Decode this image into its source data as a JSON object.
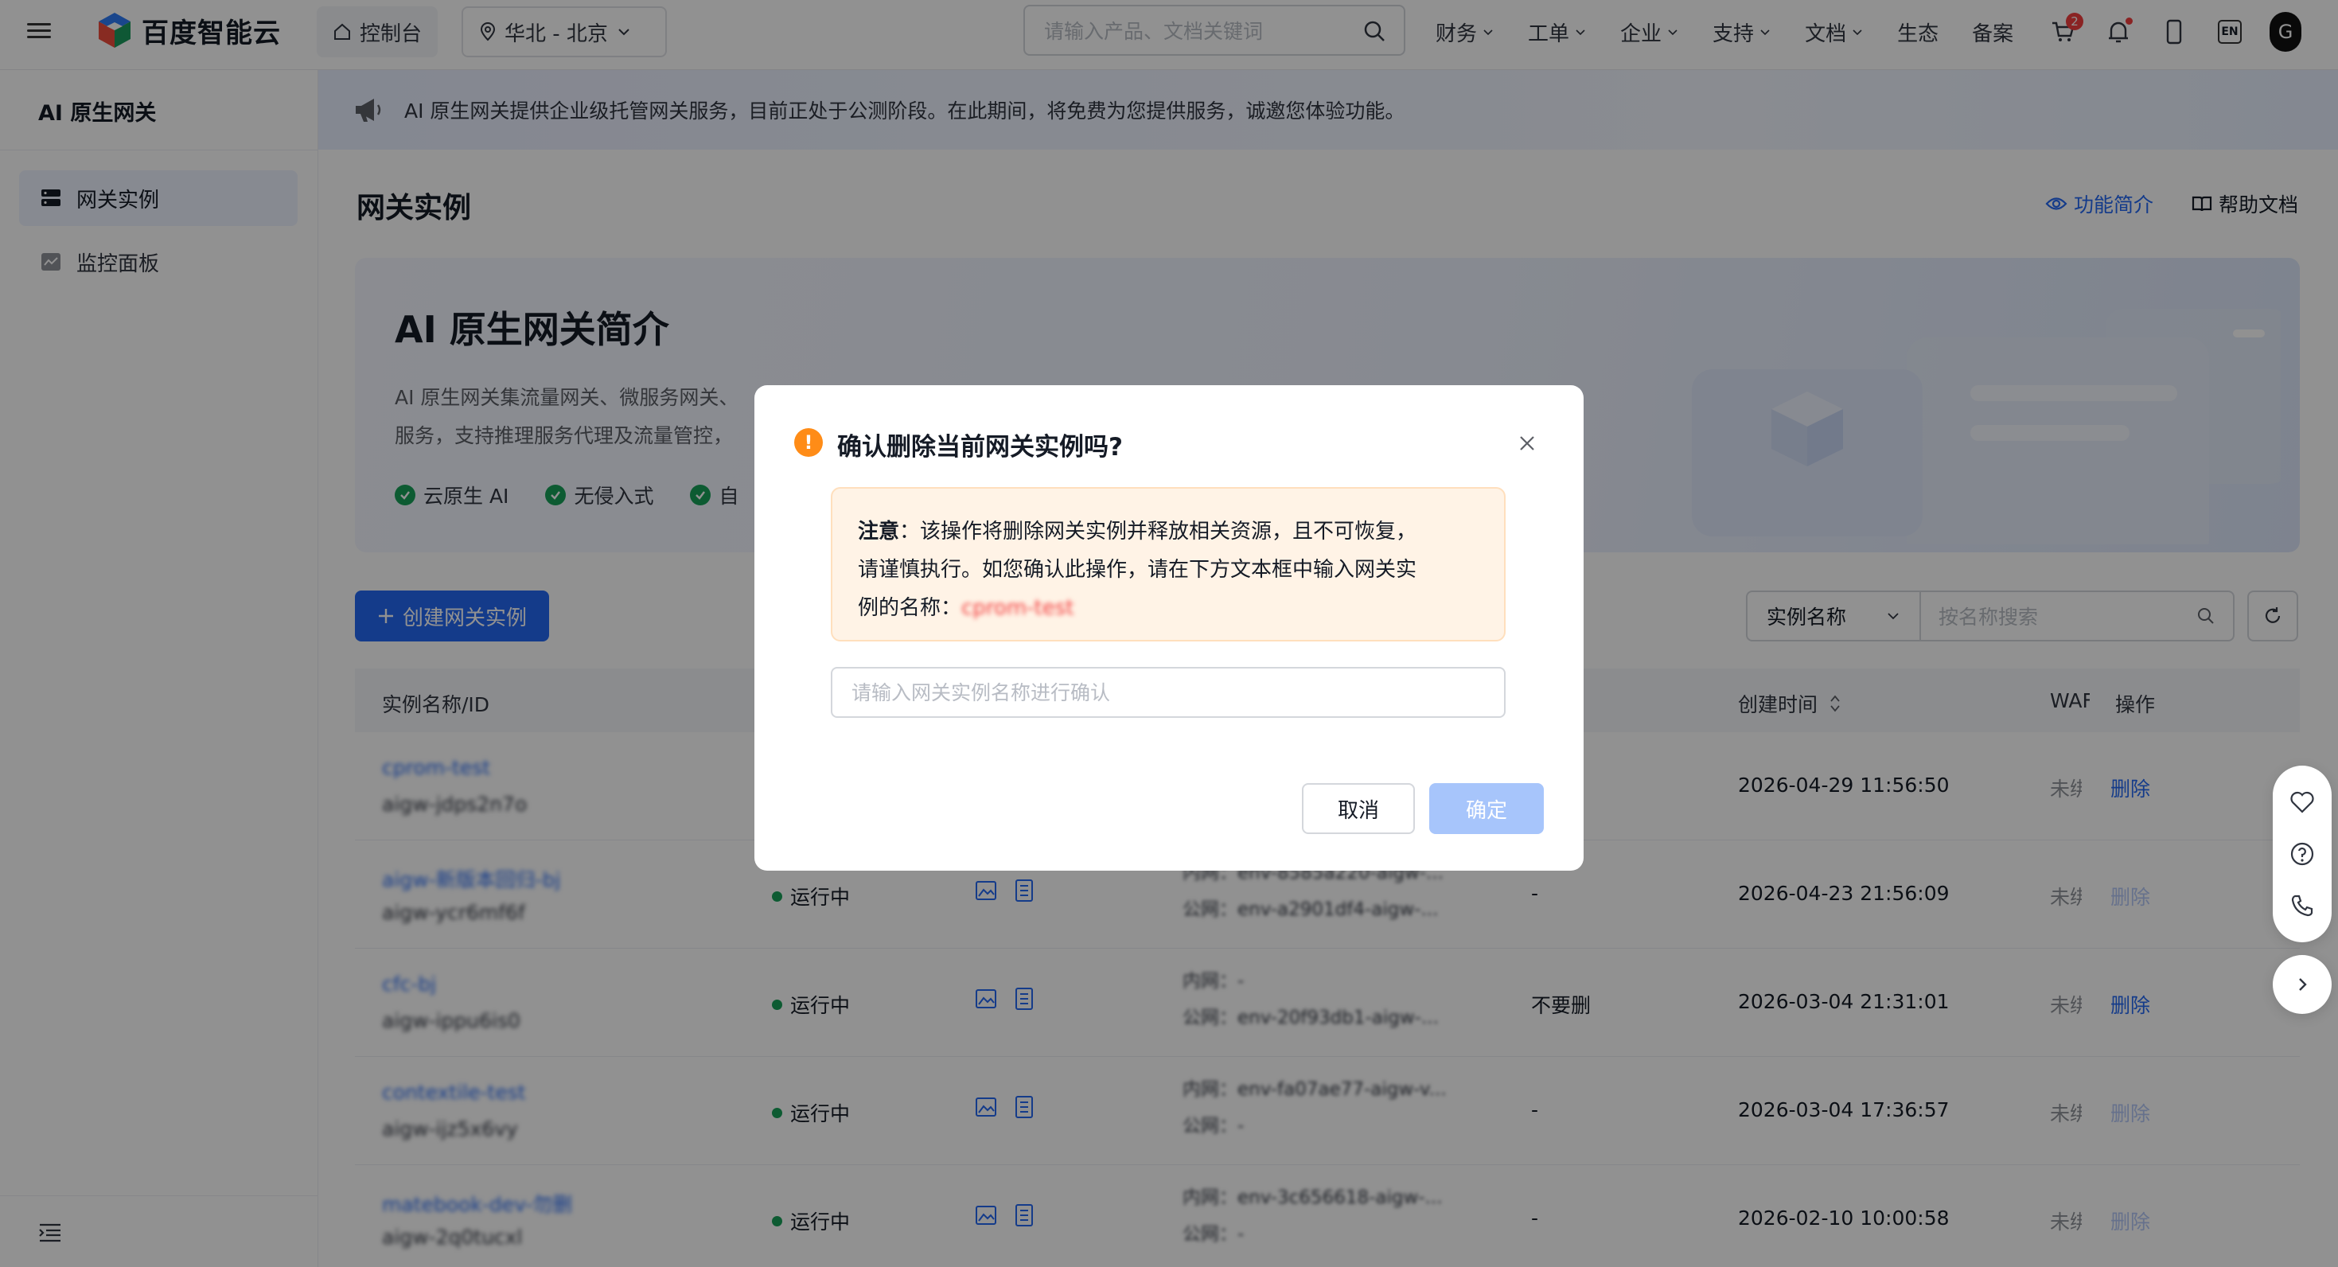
{
  "header": {
    "brand": "百度智能云",
    "console": "控制台",
    "region": "华北 - 北京",
    "search_placeholder": "请输入产品、文档关键词",
    "nav": [
      "财务",
      "工单",
      "企业",
      "支持",
      "文档",
      "生态",
      "备案"
    ],
    "cart_count": "2",
    "lang": "EN",
    "avatar": "G"
  },
  "sidebar": {
    "title": "AI 原生网关",
    "items": [
      {
        "label": "网关实例",
        "active": true
      },
      {
        "label": "监控面板",
        "active": false
      }
    ]
  },
  "banner": {
    "text": "AI 原生网关提供企业级托管网关服务，目前正处于公测阶段。在此期间，将免费为您提供服务，诚邀您体验功能。"
  },
  "page": {
    "title": "网关实例",
    "feature_link": "功能简介",
    "help_link": "帮助文档"
  },
  "intro": {
    "title": "AI 原生网关简介",
    "desc_line1": "AI 原生网关集流量网关、微服务网关、",
    "desc_line2": "服务，支持推理服务代理及流量管控，",
    "tags": [
      "云原生 AI",
      "无侵入式",
      "自"
    ]
  },
  "toolbar": {
    "create_label": "创建网关实例",
    "filter_select": "实例名称",
    "filter_placeholder": "按名称搜索"
  },
  "table": {
    "headers": {
      "name": "实例名称/ID",
      "created": "创建时间",
      "waf": "WAF",
      "ops": "操作"
    },
    "rows": [
      {
        "name": "cprom-test",
        "id": "aigw-jdps2n7o",
        "status": "",
        "net1": "",
        "net2": "",
        "desc": "",
        "created": "2026-04-29 11:56:50",
        "waf": "未绑",
        "op": "删除",
        "op_disabled": false
      },
      {
        "name": "aigw-新版本回归-bj",
        "id": "aigw-ycr6mf6f",
        "status": "运行中",
        "net1": "内网：env-8585a220-aigw-...",
        "net2": "公网：env-a2901df4-aigw-...",
        "desc": "-",
        "created": "2026-04-23 21:56:09",
        "waf": "未绑",
        "op": "删除",
        "op_disabled": true
      },
      {
        "name": "cfc-bj",
        "id": "aigw-ippu6is0",
        "status": "运行中",
        "net1": "内网：-",
        "net2": "公网：env-20f93db1-aigw-...",
        "desc": "不要删",
        "created": "2026-03-04 21:31:01",
        "waf": "未绑",
        "op": "删除",
        "op_disabled": false
      },
      {
        "name": "contextile-test",
        "id": "aigw-ijz5x6vy",
        "status": "运行中",
        "net1": "内网：env-fa07ae77-aigw-v...",
        "net2": "公网：-",
        "desc": "-",
        "created": "2026-03-04 17:36:57",
        "waf": "未绑",
        "op": "删除",
        "op_disabled": true
      },
      {
        "name": "matebook-dev-勿删",
        "id": "aigw-2q0tucxl",
        "status": "运行中",
        "net1": "内网：env-3c656618-aigw-...",
        "net2": "公网：-",
        "desc": "-",
        "created": "2026-02-10 10:00:58",
        "waf": "未绑",
        "op": "删除",
        "op_disabled": true
      }
    ]
  },
  "dialog": {
    "title": "确认删除当前网关实例吗?",
    "notice_bold": "注意",
    "notice_line1": "：该操作将删除网关实例并释放相关资源，且不可恢复，",
    "notice_line2": "请谨慎执行。如您确认此操作，请在下方文本框中输入网关实",
    "notice_line3": "例的名称：",
    "instance_name": "cprom-test",
    "input_placeholder": "请输入网关实例名称进行确认",
    "input_value": "",
    "cancel": "取消",
    "confirm": "确定"
  },
  "colors": {
    "primary": "#2468f2",
    "primary_disabled": "#a7c5fb",
    "warning": "#ff8c17",
    "danger": "#f33e3e",
    "success": "#18a058"
  }
}
